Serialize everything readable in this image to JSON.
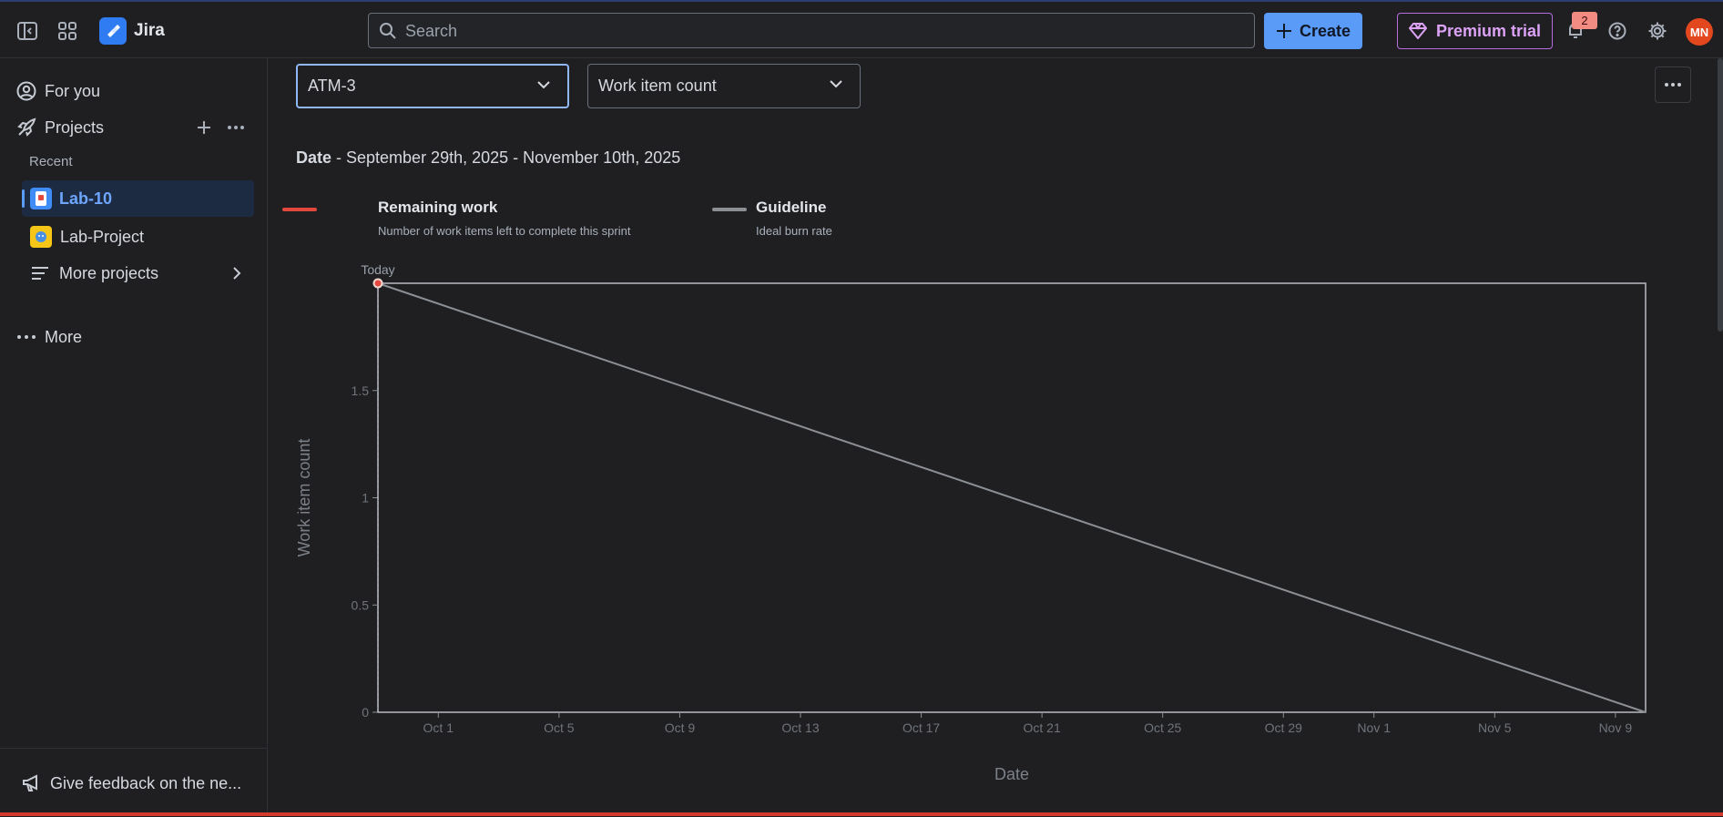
{
  "header": {
    "app_name": "Jira",
    "search_placeholder": "Search",
    "create_label": "Create",
    "premium_label": "Premium trial",
    "notification_count": "2",
    "avatar_initials": "MN",
    "colors": {
      "create_bg": "#5a9bf7",
      "premium_border": "#b66de0",
      "avatar_bg": "#e2471d"
    }
  },
  "sidebar": {
    "for_you": "For you",
    "projects": "Projects",
    "recent_label": "Recent",
    "projects_list": [
      {
        "name": "Lab-10",
        "selected": true
      },
      {
        "name": "Lab-Project",
        "selected": false
      }
    ],
    "more_projects": "More projects",
    "more": "More",
    "feedback": "Give feedback on the ne..."
  },
  "report": {
    "sprint_select": "ATM-3",
    "metric_select": "Work item count",
    "date_label": "Date",
    "date_range": " - September 29th, 2025 - November 10th, 2025",
    "legend": [
      {
        "title": "Remaining work",
        "desc": "Number of work items left to complete this sprint",
        "color": "#e2483d"
      },
      {
        "title": "Guideline",
        "desc": "Ideal burn rate",
        "color": "#8c8f94"
      }
    ]
  },
  "chart_data": {
    "type": "line",
    "title": "",
    "xlabel": "Date",
    "ylabel": "Work item count",
    "ylim": [
      0,
      2
    ],
    "yticks": [
      0,
      0.5,
      1,
      1.5
    ],
    "ytick_labels": [
      "0",
      "0.5",
      "1",
      "1.5"
    ],
    "xlim": [
      "2025-09-29",
      "2025-11-10"
    ],
    "xtick_dates": [
      "2025-10-01",
      "2025-10-05",
      "2025-10-09",
      "2025-10-13",
      "2025-10-17",
      "2025-10-21",
      "2025-10-25",
      "2025-10-29",
      "2025-11-01",
      "2025-11-05",
      "2025-11-09"
    ],
    "xtick_labels": [
      "Oct 1",
      "Oct 5",
      "Oct 9",
      "Oct 13",
      "Oct 17",
      "Oct 21",
      "Oct 25",
      "Oct 29",
      "Nov 1",
      "Nov 5",
      "Nov 9"
    ],
    "today_label": "Today",
    "today_date": "2025-09-29",
    "series": [
      {
        "name": "Remaining work",
        "color": "#e2483d",
        "points": [
          {
            "x": "2025-09-29",
            "y": 2
          }
        ]
      },
      {
        "name": "Guideline",
        "color": "#8c8f94",
        "points": [
          {
            "x": "2025-09-29",
            "y": 2
          },
          {
            "x": "2025-11-10",
            "y": 0
          }
        ]
      }
    ]
  }
}
